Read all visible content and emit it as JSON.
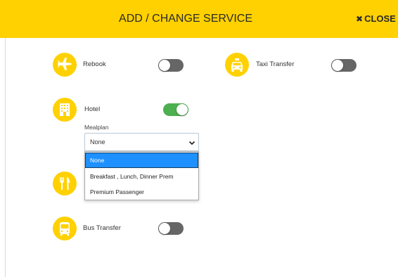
{
  "header": {
    "title": "ADD / CHANGE SERVICE",
    "close_label": "CLOSE",
    "close_glyph": "✖",
    "background": "#ffd100"
  },
  "services": {
    "rebook": {
      "label": "Rebook",
      "icon": "airplane-icon",
      "enabled": false
    },
    "taxi": {
      "label": "Taxi Transfer",
      "icon": "taxi-icon",
      "enabled": false
    },
    "hotel": {
      "label": "Hotel",
      "icon": "hotel-icon",
      "enabled": true
    },
    "meal": {
      "icon": "utensils-icon"
    },
    "bus": {
      "label": "Bus Transfer",
      "icon": "bus-icon",
      "enabled": false
    }
  },
  "mealplan": {
    "label": "Mealplan",
    "selected": "None",
    "options": [
      "None",
      "Breakfast , Lunch, Dinner Prem",
      "Premium Passenger"
    ]
  },
  "colors": {
    "accent": "#ffd100",
    "toggle_on": "#4caf50",
    "toggle_off": "#666666",
    "option_highlight": "#1e90ff"
  }
}
